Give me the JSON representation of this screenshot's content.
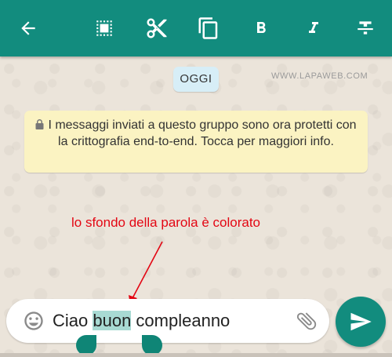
{
  "colors": {
    "toolbar": "#128c7e",
    "wallpaper": "#ebe4da",
    "date_chip": "#d7eef7",
    "system_message": "#fbf3c2",
    "selection_highlight": "#a8dad3",
    "annotation": "#e30613",
    "send_button": "#128c7e"
  },
  "toolbar": {
    "icons": [
      "back-arrow-icon",
      "select-all-icon",
      "cut-icon",
      "copy-icon",
      "bold-icon",
      "italic-icon",
      "strikethrough-icon"
    ]
  },
  "chat": {
    "date_label": "OGGI",
    "watermark": "WWW.LAPAWEB.COM",
    "system_message": "I messaggi inviati a questo gruppo sono ora protetti con la crittografia end-to-end. Tocca per maggiori info."
  },
  "annotation": {
    "text": "lo sfondo della parola è colorato"
  },
  "composer": {
    "text_before": "Ciao ",
    "selected_text": "buon",
    "text_after": " compleanno",
    "icons": [
      "emoji-icon",
      "paperclip-icon",
      "send-icon"
    ]
  }
}
